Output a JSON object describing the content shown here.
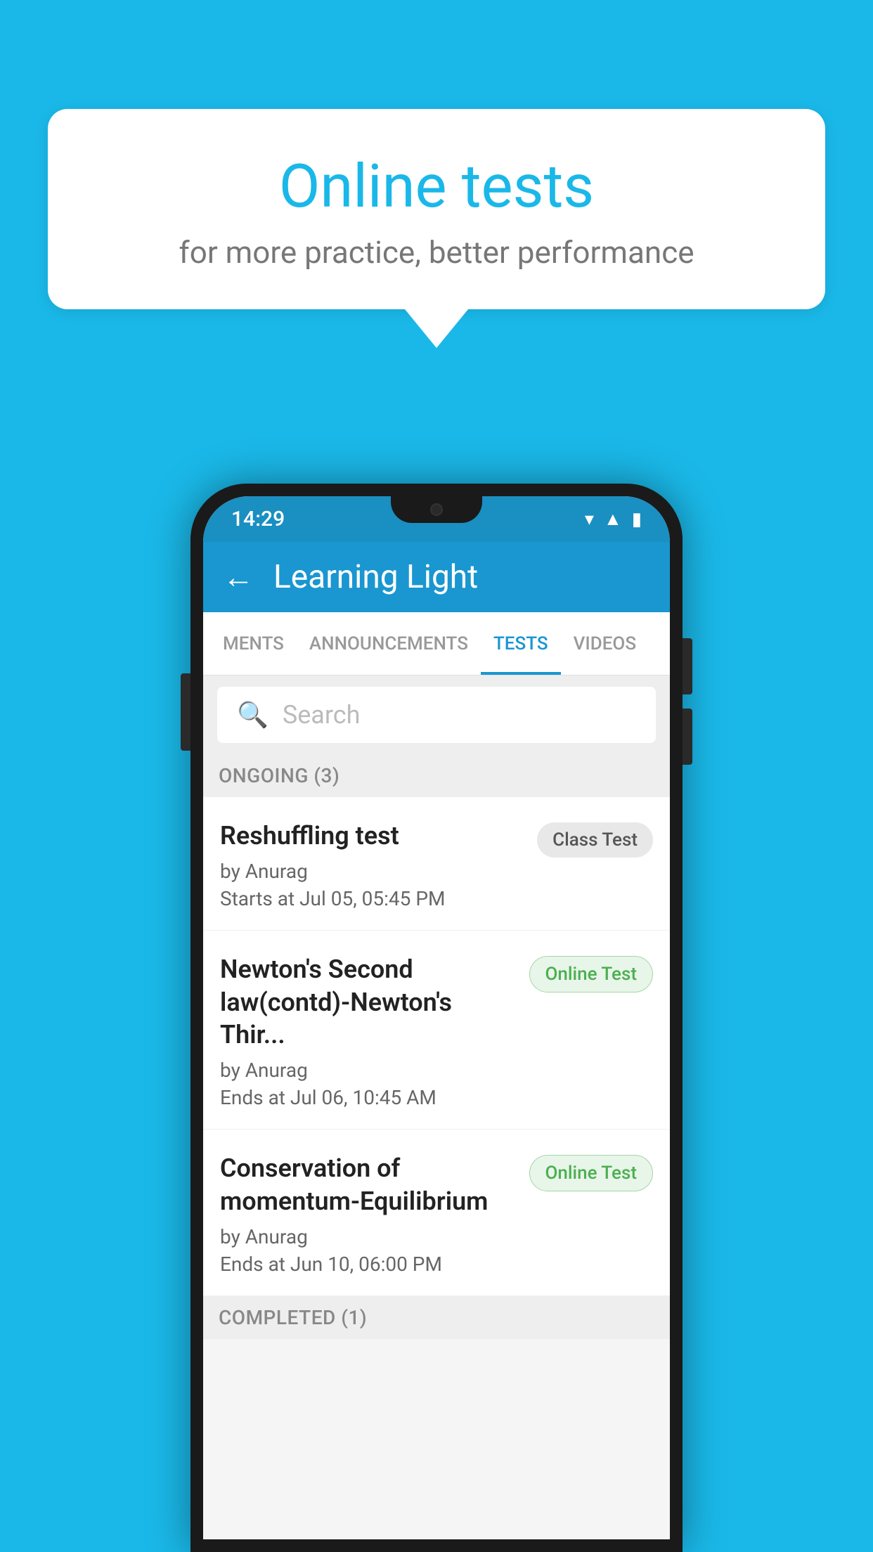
{
  "background_color": "#1ab8e8",
  "speech_bubble": {
    "title": "Online tests",
    "subtitle": "for more practice, better performance"
  },
  "phone": {
    "status_bar": {
      "time": "14:29",
      "icons": [
        "wifi",
        "signal",
        "battery"
      ]
    },
    "app_bar": {
      "title": "Learning Light",
      "back_label": "←"
    },
    "tabs": [
      {
        "label": "MENTS",
        "active": false
      },
      {
        "label": "ANNOUNCEMENTS",
        "active": false
      },
      {
        "label": "TESTS",
        "active": true
      },
      {
        "label": "VIDEOS",
        "active": false
      }
    ],
    "search": {
      "placeholder": "Search"
    },
    "section_ongoing": {
      "label": "ONGOING (3)"
    },
    "test_items": [
      {
        "title": "Reshuffling test",
        "author": "by Anurag",
        "date": "Starts at  Jul 05, 05:45 PM",
        "badge": "Class Test",
        "badge_type": "class"
      },
      {
        "title": "Newton's Second law(contd)-Newton's Thir...",
        "author": "by Anurag",
        "date": "Ends at  Jul 06, 10:45 AM",
        "badge": "Online Test",
        "badge_type": "online"
      },
      {
        "title": "Conservation of momentum-Equilibrium",
        "author": "by Anurag",
        "date": "Ends at  Jun 10, 06:00 PM",
        "badge": "Online Test",
        "badge_type": "online"
      }
    ],
    "section_completed": {
      "label": "COMPLETED (1)"
    }
  }
}
